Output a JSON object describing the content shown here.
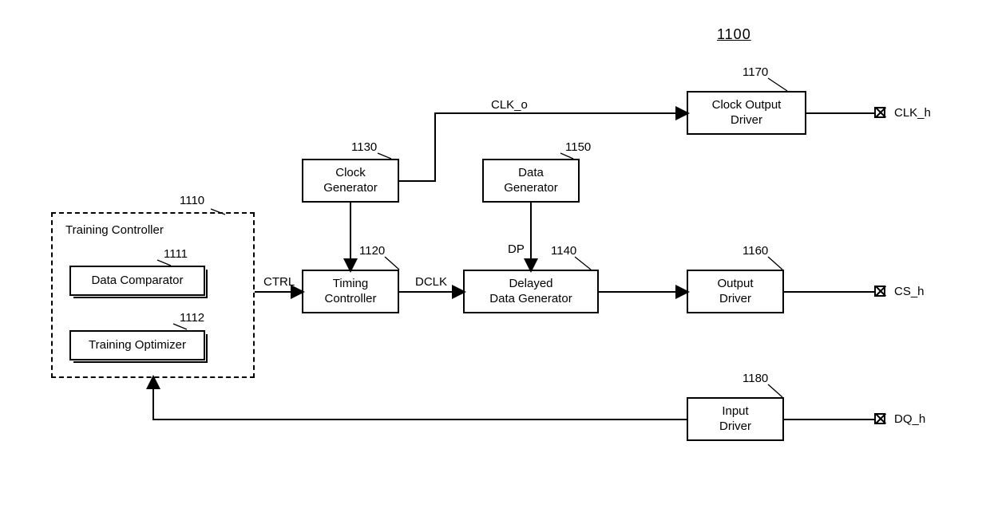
{
  "chart_data": {
    "type": "block-diagram",
    "reference": "1100",
    "blocks": [
      {
        "id": "1110",
        "name": "Training Controller",
        "contains": [
          "1111",
          "1112"
        ]
      },
      {
        "id": "1111",
        "name": "Data Comparator"
      },
      {
        "id": "1112",
        "name": "Training Optimizer"
      },
      {
        "id": "1120",
        "name": "Timing Controller"
      },
      {
        "id": "1130",
        "name": "Clock Generator"
      },
      {
        "id": "1140",
        "name": "Delayed Data Generator"
      },
      {
        "id": "1150",
        "name": "Data Generator"
      },
      {
        "id": "1160",
        "name": "Output Driver"
      },
      {
        "id": "1170",
        "name": "Clock Output Driver"
      },
      {
        "id": "1180",
        "name": "Input Driver"
      }
    ],
    "signals": [
      {
        "name": "CTRL",
        "from": "1110",
        "to": "1120"
      },
      {
        "name": "DCLK",
        "from": "1120",
        "to": "1140"
      },
      {
        "name": "DP",
        "from": "1150",
        "to": "1140"
      },
      {
        "name": "CLK_o",
        "from": "1130",
        "to": "1170"
      }
    ],
    "ports": [
      {
        "name": "CLK_h",
        "from": "1170"
      },
      {
        "name": "CS_h",
        "from": "1160"
      },
      {
        "name": "DQ_h",
        "to": "1180"
      }
    ],
    "edges": [
      {
        "from": "1130",
        "to": "1120"
      },
      {
        "from": "1140",
        "to": "1160"
      },
      {
        "from": "1180",
        "to": "1110"
      }
    ]
  },
  "refnum_main": "1100",
  "refnums": {
    "r1110": "1110",
    "r1111": "1111",
    "r1112": "1112",
    "r1120": "1120",
    "r1130": "1130",
    "r1140": "1140",
    "r1150": "1150",
    "r1160": "1160",
    "r1170": "1170",
    "r1180": "1180"
  },
  "blocks": {
    "trainingController": "Training Controller",
    "dataComparator": "Data Comparator",
    "trainingOptimizer": "Training Optimizer",
    "timingController": "Timing\nController",
    "clockGenerator": "Clock\nGenerator",
    "delayedDataGenerator": "Delayed\nData Generator",
    "dataGenerator": "Data\nGenerator",
    "outputDriver": "Output\nDriver",
    "clockOutputDriver": "Clock Output\nDriver",
    "inputDriver": "Input\nDriver"
  },
  "signals": {
    "ctrl": "CTRL",
    "dclk": "DCLK",
    "dp": "DP",
    "clk_o": "CLK_o"
  },
  "ports": {
    "clk_h": "CLK_h",
    "cs_h": "CS_h",
    "dq_h": "DQ_h"
  }
}
